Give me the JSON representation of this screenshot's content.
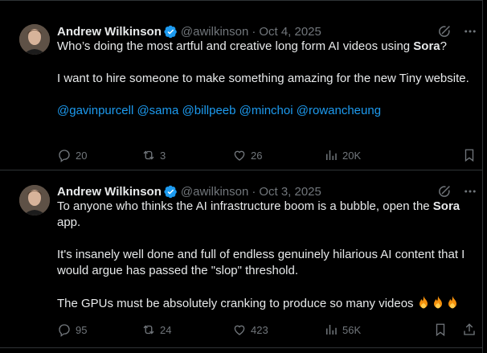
{
  "colors": {
    "background": "#000000",
    "text": "#e7e9ea",
    "muted": "#71767b",
    "accent": "#1d9bf0",
    "divider": "#2f3336"
  },
  "tweets": [
    {
      "author_name": "Andrew Wilkinson",
      "author_handle": "@awilkinson",
      "separator": "·",
      "date": "Oct 4, 2025",
      "body": {
        "line1_prefix": "Who’s doing the most artful and creative long form AI videos using ",
        "line1_bold": "Sora",
        "line1_suffix": "?",
        "para2": "I want to hire someone to make something amazing for the new Tiny website.",
        "mentions": [
          "@gavinpurcell",
          "@sama",
          "@billpeeb",
          "@minchoi",
          "@rowancheung"
        ]
      },
      "counts": {
        "replies": "20",
        "reposts": "3",
        "likes": "26",
        "views": "20K"
      },
      "icons": [
        "verified-icon",
        "grok-icon",
        "more-icon",
        "reply-icon",
        "repost-icon",
        "like-icon",
        "views-icon",
        "bookmark-icon"
      ]
    },
    {
      "author_name": "Andrew Wilkinson",
      "author_handle": "@awilkinson",
      "separator": "·",
      "date": "Oct 3, 2025",
      "body": {
        "para1_prefix": "To anyone who thinks the AI infrastructure boom is a bubble, open the ",
        "para1_bold": "Sora",
        "para1_suffix": " app.",
        "para2": "It's insanely well done and full of endless genuinely hilarious AI content that I would argue has passed the \"slop\" threshold.",
        "para3": "The GPUs must be absolutely cranking to produce so many videos",
        "emoji": [
          "fire",
          "fire",
          "fire"
        ]
      },
      "counts": {
        "replies": "95",
        "reposts": "24",
        "likes": "423",
        "views": "56K"
      },
      "icons": [
        "verified-icon",
        "grok-icon",
        "more-icon",
        "reply-icon",
        "repost-icon",
        "like-icon",
        "views-icon",
        "bookmark-icon",
        "share-icon"
      ]
    }
  ]
}
